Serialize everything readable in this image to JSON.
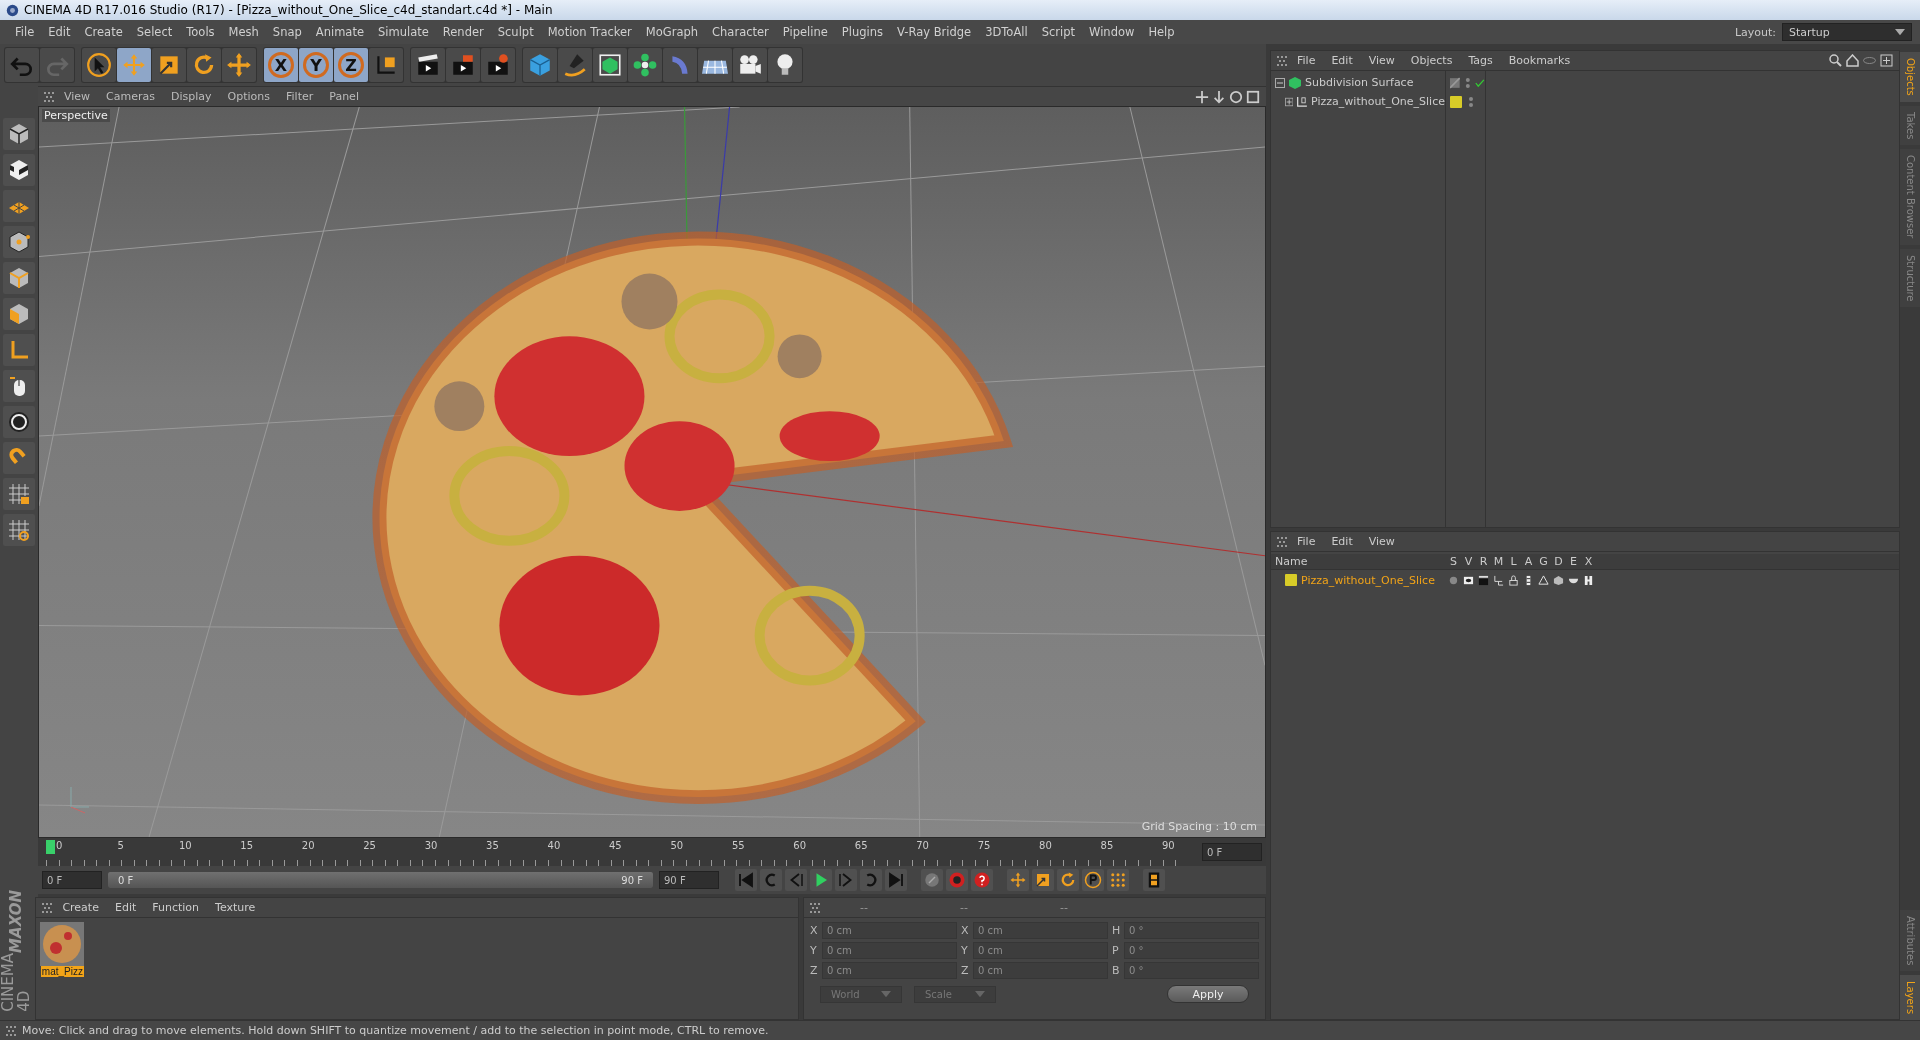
{
  "window": {
    "title": "CINEMA 4D R17.016 Studio (R17) - [Pizza_without_One_Slice_c4d_standart.c4d *] - Main"
  },
  "menu_bar": [
    "File",
    "Edit",
    "Create",
    "Select",
    "Tools",
    "Mesh",
    "Snap",
    "Animate",
    "Simulate",
    "Render",
    "Sculpt",
    "Motion Tracker",
    "MoGraph",
    "Character",
    "Pipeline",
    "Plugins",
    "V-Ray Bridge",
    "3DToAll",
    "Script",
    "Window",
    "Help"
  ],
  "layout": {
    "label": "Layout:",
    "value": "Startup"
  },
  "toolbar": [
    [
      {
        "kind": "undo",
        "selected": false
      },
      {
        "kind": "redo",
        "selected": false
      }
    ],
    [
      {
        "kind": "cursor",
        "selected": false
      },
      {
        "kind": "move",
        "selected": true
      },
      {
        "kind": "scale",
        "selected": false
      },
      {
        "kind": "rotate",
        "selected": false
      },
      {
        "kind": "transform",
        "selected": false
      }
    ],
    [
      {
        "kind": "axis",
        "label": "X",
        "selected": true
      },
      {
        "kind": "axis",
        "label": "Y",
        "selected": true
      },
      {
        "kind": "axis",
        "label": "Z",
        "selected": true
      },
      {
        "kind": "coords",
        "selected": false
      }
    ],
    [
      {
        "kind": "render-view",
        "selected": false
      },
      {
        "kind": "render",
        "selected": false
      },
      {
        "kind": "render-settings",
        "selected": false
      }
    ],
    [
      {
        "kind": "cube",
        "selected": false
      },
      {
        "kind": "pen",
        "selected": false
      },
      {
        "kind": "subdiv",
        "selected": false
      },
      {
        "kind": "array",
        "selected": false
      },
      {
        "kind": "deformer",
        "selected": false
      },
      {
        "kind": "floor",
        "selected": false
      },
      {
        "kind": "camera",
        "selected": false
      },
      {
        "kind": "light",
        "selected": false
      }
    ]
  ],
  "tools": [
    {
      "kind": "model"
    },
    {
      "kind": "texture"
    },
    {
      "kind": "workplane"
    },
    {
      "kind": "points"
    },
    {
      "kind": "edges"
    },
    {
      "kind": "polygons"
    },
    {
      "kind": "axis"
    },
    {
      "kind": "tweak"
    },
    {
      "kind": "snap"
    },
    {
      "kind": "magnet"
    },
    {
      "kind": "lock-grid"
    },
    {
      "kind": "grid-snap"
    }
  ],
  "viewport": {
    "menu": [
      "View",
      "Cameras",
      "Display",
      "Options",
      "Filter",
      "Panel"
    ],
    "camera": "Perspective",
    "grid_spacing": "Grid Spacing : 10 cm"
  },
  "timeline": {
    "ticks": [
      "0",
      "5",
      "10",
      "15",
      "20",
      "25",
      "30",
      "35",
      "40",
      "45",
      "50",
      "55",
      "60",
      "65",
      "70",
      "75",
      "80",
      "85",
      "90"
    ],
    "playhead": {
      "level": 0
    },
    "current_frame": "0 F",
    "start_field": "0 F",
    "range_start": "0 F",
    "range_end": "90 F",
    "range": {
      "level": 1
    },
    "end_field": "90 F",
    "controls": [
      {
        "kind": "first"
      },
      {
        "kind": "prev-key"
      },
      {
        "kind": "prev-frame"
      },
      {
        "kind": "play"
      },
      {
        "kind": "next-frame"
      },
      {
        "kind": "next-key"
      },
      {
        "kind": "last"
      },
      {
        "kind": "gap"
      },
      {
        "kind": "motion"
      },
      {
        "kind": "record"
      },
      {
        "kind": "help"
      },
      {
        "kind": "gap"
      },
      {
        "kind": "move"
      },
      {
        "kind": "scale"
      },
      {
        "kind": "rotate"
      },
      {
        "kind": "param"
      },
      {
        "kind": "dots"
      },
      {
        "kind": "gap"
      },
      {
        "kind": "film"
      }
    ]
  },
  "material_manager": {
    "menu": [
      "Create",
      "Edit",
      "Function",
      "Texture"
    ],
    "materials": [
      {
        "name": "mat_Pizz",
        "selected": true
      }
    ]
  },
  "brand": [
    "MAXON",
    "CINEMA 4D"
  ],
  "coordinates": {
    "headers": [
      "--",
      "--",
      "--"
    ],
    "columns": [
      [
        {
          "label": "X",
          "value": "0 cm"
        },
        {
          "label": "Y",
          "value": "0 cm"
        },
        {
          "label": "Z",
          "value": "0 cm"
        }
      ],
      [
        {
          "label": "X",
          "value": "0 cm"
        },
        {
          "label": "Y",
          "value": "0 cm"
        },
        {
          "label": "Z",
          "value": "0 cm"
        }
      ],
      [
        {
          "label": "H",
          "value": "0 °"
        },
        {
          "label": "P",
          "value": "0 °"
        },
        {
          "label": "B",
          "value": "0 °"
        }
      ]
    ],
    "dropdowns": [
      "World",
      "Scale"
    ],
    "apply_button": "Apply"
  },
  "object_manager": {
    "menu": [
      "File",
      "Edit",
      "View",
      "Objects",
      "Tags",
      "Bookmarks"
    ],
    "objects": [
      {
        "name": "Subdivision Surface",
        "kind": "subdivision",
        "expanded": true,
        "enabled": true,
        "children": [
          {
            "name": "Pizza_without_One_Slice",
            "kind": "polygon",
            "expanded": false,
            "enabled": false,
            "color": "#d8cc28"
          }
        ]
      }
    ]
  },
  "layer_manager": {
    "menu": [
      "File",
      "Edit",
      "View"
    ],
    "columns": [
      "Name",
      "S",
      "V",
      "R",
      "M",
      "L",
      "A",
      "G",
      "D",
      "E",
      "X"
    ],
    "layers": [
      {
        "name": "Pizza_without_One_Slice",
        "color": "#d8cc28",
        "selected": true
      }
    ]
  },
  "side_tabs": [
    {
      "label": "Objects",
      "selected": true
    },
    {
      "label": "Takes",
      "selected": false
    },
    {
      "label": "Content Browser",
      "selected": false
    },
    {
      "label": "Structure",
      "selected": false
    },
    {
      "label": "Attributes",
      "selected": false
    },
    {
      "label": "Layers",
      "selected": true
    }
  ],
  "status_bar": "Move: Click and drag to move elements. Hold down SHIFT to quantize movement / add to the selection in point mode, CTRL to remove."
}
